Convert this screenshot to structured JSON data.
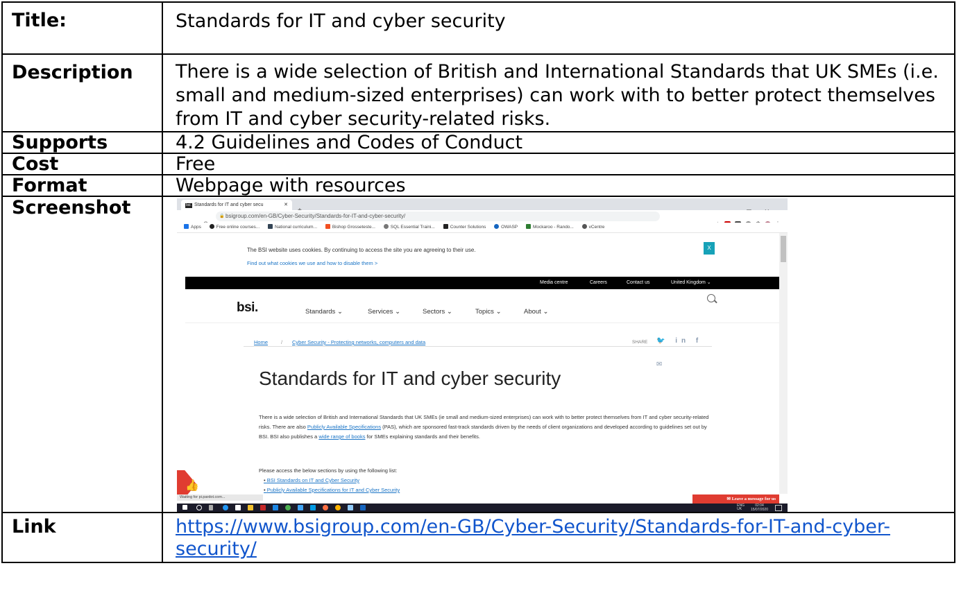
{
  "rows": {
    "title": {
      "label": "Title:",
      "value": "Standards for IT and cyber security"
    },
    "description": {
      "label": "Description",
      "value": "There is a wide selection of British and International Standards that UK SMEs (i.e. small and medium-sized enterprises) can work with to better protect themselves from IT and cyber security-related risks."
    },
    "supports": {
      "label": "Supports",
      "value": "4.2 Guidelines and Codes of Conduct"
    },
    "cost": {
      "label": "Cost",
      "value": "Free"
    },
    "format": {
      "label": "Format",
      "value": "Webpage with resources"
    },
    "screenshot": {
      "label": "Screenshot"
    },
    "link": {
      "label": "Link",
      "value": "https://www.bsigroup.com/en-GB/Cyber-Security/Standards-for-IT-and-cyber-security/"
    }
  },
  "browser": {
    "tab_title": "Standards for IT and cyber secu",
    "tab_favicon": "bsi.",
    "url": "bsigroup.com/en-GB/Cyber-Security/Standards-for-IT-and-cyber-security/",
    "bookmarks": [
      "Apps",
      "Free online courses...",
      "National curriculum...",
      "Bishop Grosseteste...",
      "SQL Essential Traini...",
      "Counter Solutions",
      "OWASP",
      "Mockaroo - Rando...",
      "vCentre"
    ],
    "status_text": "Waiting for pi.pardot.com..."
  },
  "site": {
    "cookie_text": "The BSI website uses cookies. By continuing to access the site you are agreeing to their use.",
    "cookie_link": "Find out what cookies we use and how to disable them >",
    "cookie_close": "X",
    "top_links": [
      "Media centre",
      "Careers",
      "Contact us",
      "United Kingdom ⌄"
    ],
    "logo": "bsi.",
    "menu": [
      "Standards ⌄",
      "Services ⌄",
      "Sectors ⌄",
      "Topics ⌄",
      "About ⌄"
    ],
    "crumb_home": "Home",
    "crumb_sep": "/",
    "crumb_current": "Cyber Security - Protecting networks, computers and data",
    "share_label": "SHARE",
    "share_icons": "🐦 in f ✉",
    "heading": "Standards for IT and cyber security",
    "para_part1": "There is a wide selection of British and International Standards that UK SMEs (ie small and medium-sized enterprises) can work with to better protect themselves from IT and cyber security-related risks. There are also ",
    "para_link1": "Publicly Available Specifications",
    "para_part2": " (PAS), which are sponsored fast-track standards driven by the needs of client organizations and developed according to guidelines set out by BSI. BSI also publishes a ",
    "para_link2": "wide range of books",
    "para_part3": " for SMEs explaining standards and their benefits.",
    "para_access": "Please access the below sections by using the following list:",
    "bullets": [
      "BSI Standards on IT and Cyber Security",
      "Publicly Available Specifications for IT and Cyber Security"
    ],
    "leave_message": "Leave a message for us"
  },
  "taskbar": {
    "lang": "ENG",
    "region": "UK",
    "time": "02:04",
    "date": "15/07/2020"
  },
  "colors": {
    "link": "#1155cc",
    "bsi_link": "#1a74c6",
    "cookie_btn": "#17a2b8",
    "bsi_red": "#e03c31"
  }
}
